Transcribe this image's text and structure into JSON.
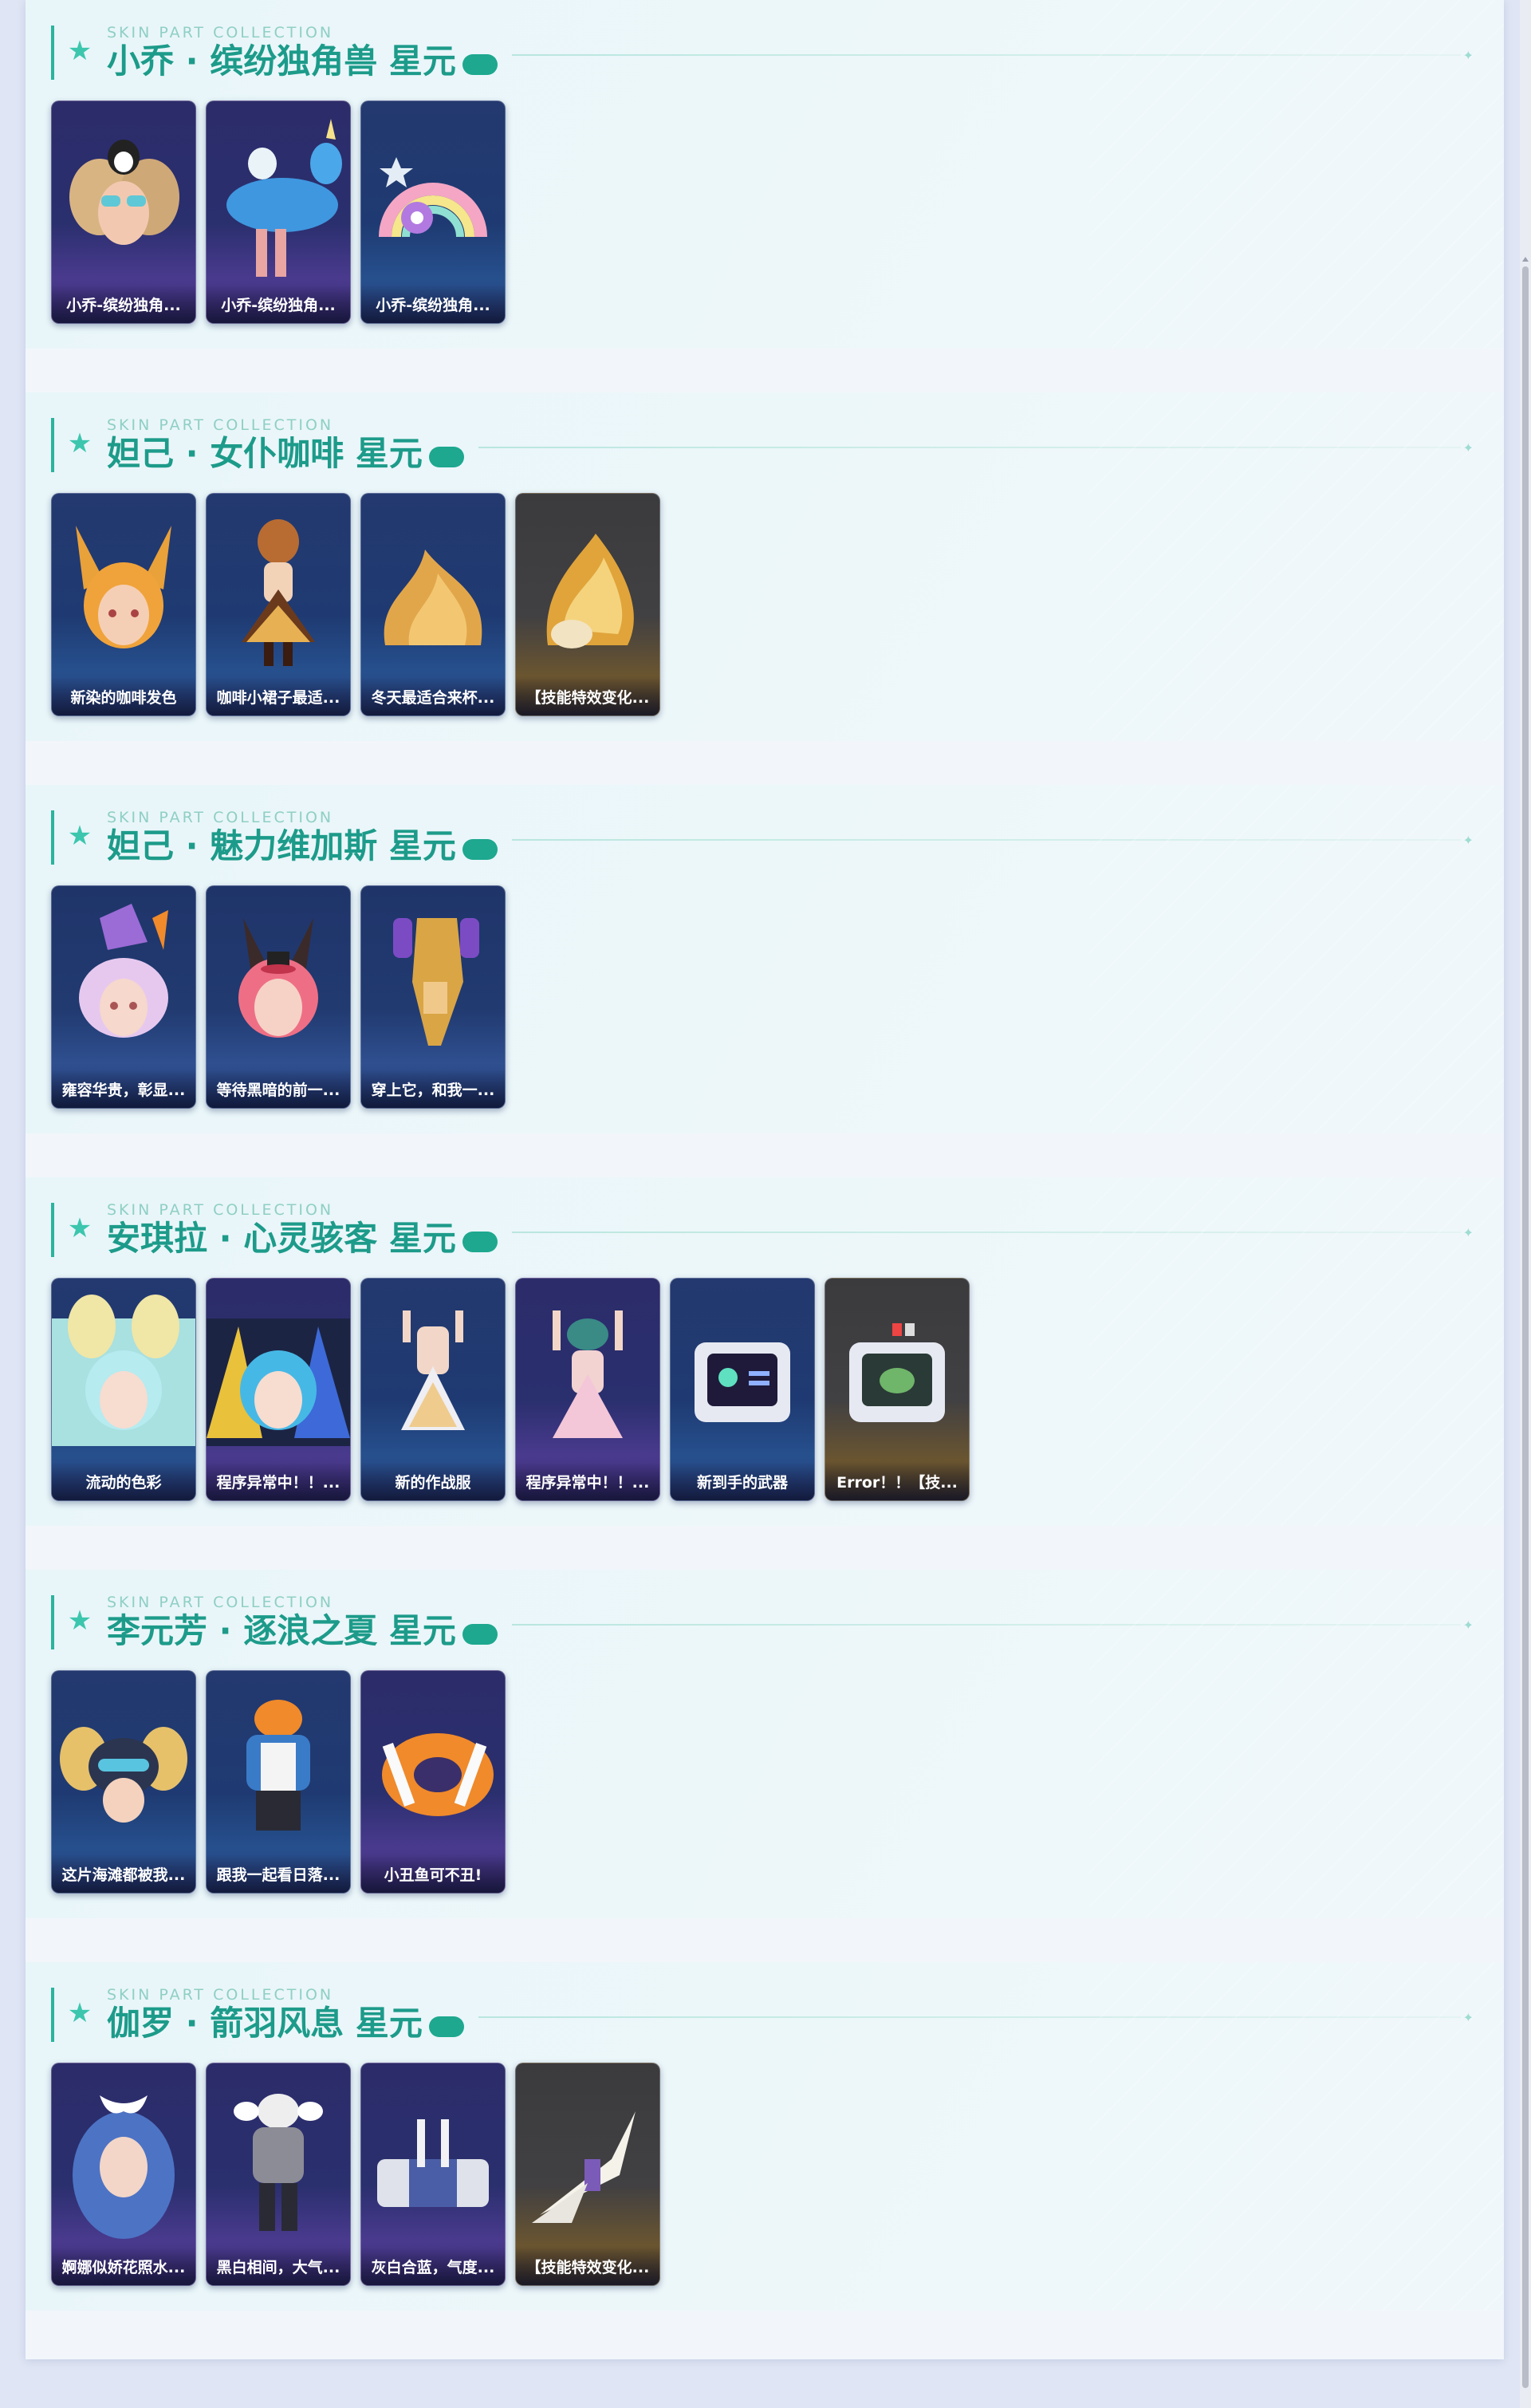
{
  "sections": [
    {
      "subtitle": "SKIN PART COLLECTION",
      "title": "小乔 · 缤纷独角兽 星元",
      "cards": [
        {
          "label": "小乔-缤纷独角...",
          "theme": "purple"
        },
        {
          "label": "小乔-缤纷独角...",
          "theme": "purple"
        },
        {
          "label": "小乔-缤纷独角...",
          "theme": "blue"
        }
      ]
    },
    {
      "subtitle": "SKIN PART COLLECTION",
      "title": "妲己 · 女仆咖啡 星元",
      "cards": [
        {
          "label": "新染的咖啡发色",
          "theme": "blue"
        },
        {
          "label": "咖啡小裙子最适...",
          "theme": "blue"
        },
        {
          "label": "冬天最适合来杯...",
          "theme": "blue"
        },
        {
          "label": "【技能特效变化...",
          "theme": "gold"
        }
      ]
    },
    {
      "subtitle": "SKIN PART COLLECTION",
      "title": "妲己 · 魅力维加斯 星元",
      "cards": [
        {
          "label": "雍容华贵，彰显...",
          "theme": "navy"
        },
        {
          "label": "等待黑暗的前一...",
          "theme": "navy"
        },
        {
          "label": "穿上它，和我一...",
          "theme": "navy"
        }
      ]
    },
    {
      "subtitle": "SKIN PART COLLECTION",
      "title": "安琪拉 · 心灵骇客 星元",
      "cards": [
        {
          "label": "流动的色彩",
          "theme": "blue"
        },
        {
          "label": "程序异常中！！...",
          "theme": "purple"
        },
        {
          "label": "新的作战服",
          "theme": "blue"
        },
        {
          "label": "程序异常中！！...",
          "theme": "purple"
        },
        {
          "label": "新到手的武器",
          "theme": "blue"
        },
        {
          "label": "Error！！【技...",
          "theme": "gold"
        }
      ]
    },
    {
      "subtitle": "SKIN PART COLLECTION",
      "title": "李元芳 · 逐浪之夏 星元",
      "cards": [
        {
          "label": "这片海滩都被我...",
          "theme": "blue"
        },
        {
          "label": "跟我一起看日落...",
          "theme": "blue"
        },
        {
          "label": "小丑鱼可不丑!",
          "theme": "purple"
        }
      ]
    },
    {
      "subtitle": "SKIN PART COLLECTION",
      "title": "伽罗 · 箭羽风息 星元",
      "cards": [
        {
          "label": "婀娜似娇花照水...",
          "theme": "purple"
        },
        {
          "label": "黑白相间，大气...",
          "theme": "purple"
        },
        {
          "label": "灰白合蓝，气度...",
          "theme": "purple"
        },
        {
          "label": "【技能特效变化...",
          "theme": "gold"
        }
      ]
    }
  ],
  "icons": {
    "section_marker": "star-icon"
  },
  "colors": {
    "accent": "#1d9b8a",
    "accent_light": "#3cc6ae",
    "pill": "#1da88f"
  }
}
